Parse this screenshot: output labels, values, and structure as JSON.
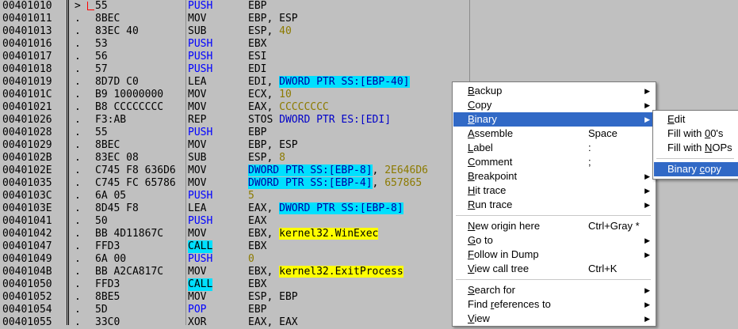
{
  "rows": [
    {
      "addr": "00401010",
      "mark": ">",
      "hex": "55",
      "mn": "PUSH",
      "mn_style": "blue",
      "op": [
        {
          "t": "EBP"
        }
      ]
    },
    {
      "addr": "00401011",
      "mark": ".",
      "hex": "8BEC",
      "mn": "MOV",
      "op": [
        {
          "t": "EBP, ESP"
        }
      ]
    },
    {
      "addr": "00401013",
      "mark": ".",
      "hex": "83EC 40",
      "mn": "SUB",
      "op": [
        {
          "t": "ESP, "
        },
        {
          "t": "40",
          "s": "olive"
        }
      ]
    },
    {
      "addr": "00401016",
      "mark": ".",
      "hex": "53",
      "mn": "PUSH",
      "mn_style": "blue",
      "op": [
        {
          "t": "EBX"
        }
      ]
    },
    {
      "addr": "00401017",
      "mark": ".",
      "hex": "56",
      "mn": "PUSH",
      "mn_style": "blue",
      "op": [
        {
          "t": "ESI"
        }
      ]
    },
    {
      "addr": "00401018",
      "mark": ".",
      "hex": "57",
      "mn": "PUSH",
      "mn_style": "blue",
      "op": [
        {
          "t": "EDI"
        }
      ]
    },
    {
      "addr": "00401019",
      "mark": ".",
      "hex": "8D7D C0",
      "mn": "LEA",
      "op": [
        {
          "t": "EDI, "
        },
        {
          "t": "DWORD PTR SS:[EBP-40]",
          "s": "mem"
        }
      ]
    },
    {
      "addr": "0040101C",
      "mark": ".",
      "hex": "B9 10000000",
      "mn": "MOV",
      "op": [
        {
          "t": "ECX, "
        },
        {
          "t": "10",
          "s": "olive"
        }
      ]
    },
    {
      "addr": "00401021",
      "mark": ".",
      "hex": "B8 CCCCCCCC",
      "mn": "MOV",
      "op": [
        {
          "t": "EAX, "
        },
        {
          "t": "CCCCCCCC",
          "s": "olive"
        }
      ]
    },
    {
      "addr": "00401026",
      "mark": ".",
      "hex": "F3:AB",
      "mn": "REP",
      "op": [
        {
          "t": "STOS "
        },
        {
          "t": "DWORD PTR ES:[EDI]",
          "s": "blue"
        }
      ]
    },
    {
      "addr": "00401028",
      "mark": ".",
      "hex": "55",
      "mn": "PUSH",
      "mn_style": "blue",
      "op": [
        {
          "t": "EBP"
        }
      ]
    },
    {
      "addr": "00401029",
      "mark": ".",
      "hex": "8BEC",
      "mn": "MOV",
      "op": [
        {
          "t": "EBP, ESP"
        }
      ]
    },
    {
      "addr": "0040102B",
      "mark": ".",
      "hex": "83EC 08",
      "mn": "SUB",
      "op": [
        {
          "t": "ESP, "
        },
        {
          "t": "8",
          "s": "olive"
        }
      ]
    },
    {
      "addr": "0040102E",
      "mark": ".",
      "hex": "C745 F8 636D6",
      "mn": "MOV",
      "op": [
        {
          "t": "DWORD PTR SS:[EBP-8]",
          "s": "mem"
        },
        {
          "t": ", "
        },
        {
          "t": "2E646D6",
          "s": "olive"
        }
      ]
    },
    {
      "addr": "00401035",
      "mark": ".",
      "hex": "C745 FC 65786",
      "mn": "MOV",
      "op": [
        {
          "t": "DWORD PTR SS:[EBP-4]",
          "s": "mem"
        },
        {
          "t": ", "
        },
        {
          "t": "657865",
          "s": "olive"
        }
      ]
    },
    {
      "addr": "0040103C",
      "mark": ".",
      "hex": "6A 05",
      "mn": "PUSH",
      "mn_style": "blue",
      "op": [
        {
          "t": "5",
          "s": "olive"
        }
      ]
    },
    {
      "addr": "0040103E",
      "mark": ".",
      "hex": "8D45 F8",
      "mn": "LEA",
      "op": [
        {
          "t": "EAX, "
        },
        {
          "t": "DWORD PTR SS:[EBP-8]",
          "s": "mem"
        }
      ]
    },
    {
      "addr": "00401041",
      "mark": ".",
      "hex": "50",
      "mn": "PUSH",
      "mn_style": "blue",
      "op": [
        {
          "t": "EAX"
        }
      ]
    },
    {
      "addr": "00401042",
      "mark": ".",
      "hex": "BB 4D11867C",
      "mn": "MOV",
      "op": [
        {
          "t": "EBX, "
        },
        {
          "t": "kernel32.WinExec",
          "s": "label"
        }
      ]
    },
    {
      "addr": "00401047",
      "mark": ".",
      "hex": "FFD3",
      "mn": "CALL",
      "mn_style": "call",
      "op": [
        {
          "t": "EBX"
        }
      ]
    },
    {
      "addr": "00401049",
      "mark": ".",
      "hex": "6A 00",
      "mn": "PUSH",
      "mn_style": "blue",
      "op": [
        {
          "t": "0",
          "s": "olive"
        }
      ]
    },
    {
      "addr": "0040104B",
      "mark": ".",
      "hex": "BB A2CA817C",
      "mn": "MOV",
      "op": [
        {
          "t": "EBX, "
        },
        {
          "t": "kernel32.ExitProcess",
          "s": "label"
        }
      ]
    },
    {
      "addr": "00401050",
      "mark": ".",
      "hex": "FFD3",
      "mn": "CALL",
      "mn_style": "call",
      "op": [
        {
          "t": "EBX"
        }
      ]
    },
    {
      "addr": "00401052",
      "mark": ".",
      "hex": "8BE5",
      "mn": "MOV",
      "op": [
        {
          "t": "ESP, EBP"
        }
      ]
    },
    {
      "addr": "00401054",
      "mark": ".",
      "hex": "5D",
      "mn": "POP",
      "mn_style": "blue",
      "op": [
        {
          "t": "EBP"
        }
      ]
    },
    {
      "addr": "00401055",
      "mark": ".",
      "hex": "33C0",
      "mn": "XOR",
      "op": [
        {
          "t": "EAX, EAX"
        }
      ]
    }
  ],
  "context_menu": {
    "items": [
      {
        "label": "Backup",
        "u": "B",
        "rest": "ackup",
        "arrow": true
      },
      {
        "label": "Copy",
        "u": "C",
        "rest": "opy",
        "arrow": true
      },
      {
        "label": "Binary",
        "u": "B",
        "rest": "inary",
        "arrow": true,
        "selected": true
      },
      {
        "label": "Assemble",
        "u": "A",
        "rest": "ssemble",
        "shortcut": "Space"
      },
      {
        "label": "Label",
        "u": "L",
        "rest": "abel",
        "shortcut": ":"
      },
      {
        "label": "Comment",
        "u": "C",
        "rest": "omment",
        "shortcut": ";"
      },
      {
        "label": "Breakpoint",
        "u": "B",
        "rest": "reakpoint",
        "arrow": true
      },
      {
        "label": "Hit trace",
        "u": "H",
        "rest": "it trace",
        "arrow": true
      },
      {
        "label": "Run trace",
        "u": "R",
        "rest": "un trace",
        "arrow": true
      },
      {
        "sep": true
      },
      {
        "label": "New origin here",
        "u": "N",
        "rest": "ew origin here",
        "shortcut": "Ctrl+Gray *"
      },
      {
        "label": "Go to",
        "u": "G",
        "rest": "o to",
        "arrow": true
      },
      {
        "label": "Follow in Dump",
        "u": "F",
        "rest": "ollow in Dump",
        "arrow": true
      },
      {
        "label": "View call tree",
        "u": "V",
        "rest": "iew call tree",
        "shortcut": "Ctrl+K"
      },
      {
        "sep": true
      },
      {
        "label": "Search for",
        "u": "S",
        "rest": "earch for",
        "arrow": true
      },
      {
        "label": "Find references to",
        "u": "r",
        "pre": "Find ",
        "rest": "eferences to",
        "arrow": true
      },
      {
        "label": "View",
        "u": "V",
        "rest": "iew",
        "arrow": true
      }
    ]
  },
  "binary_submenu": {
    "items": [
      {
        "label": "Edit",
        "u": "E",
        "rest": "dit"
      },
      {
        "label": "Fill with 00's",
        "pre": "Fill with ",
        "u": "0",
        "rest": "0's"
      },
      {
        "label": "Fill with NOPs",
        "pre": "Fill with ",
        "u": "N",
        "rest": "OPs"
      },
      {
        "sep": true
      },
      {
        "label": "Binary copy",
        "pre": "Binary ",
        "u": "c",
        "rest": "opy",
        "selected": true
      }
    ]
  },
  "colors": {
    "background": "#c0c0c0",
    "menu_selected": "#3169c6",
    "highlight_cyan": "#00e0ff",
    "highlight_yellow": "#ffff00"
  }
}
